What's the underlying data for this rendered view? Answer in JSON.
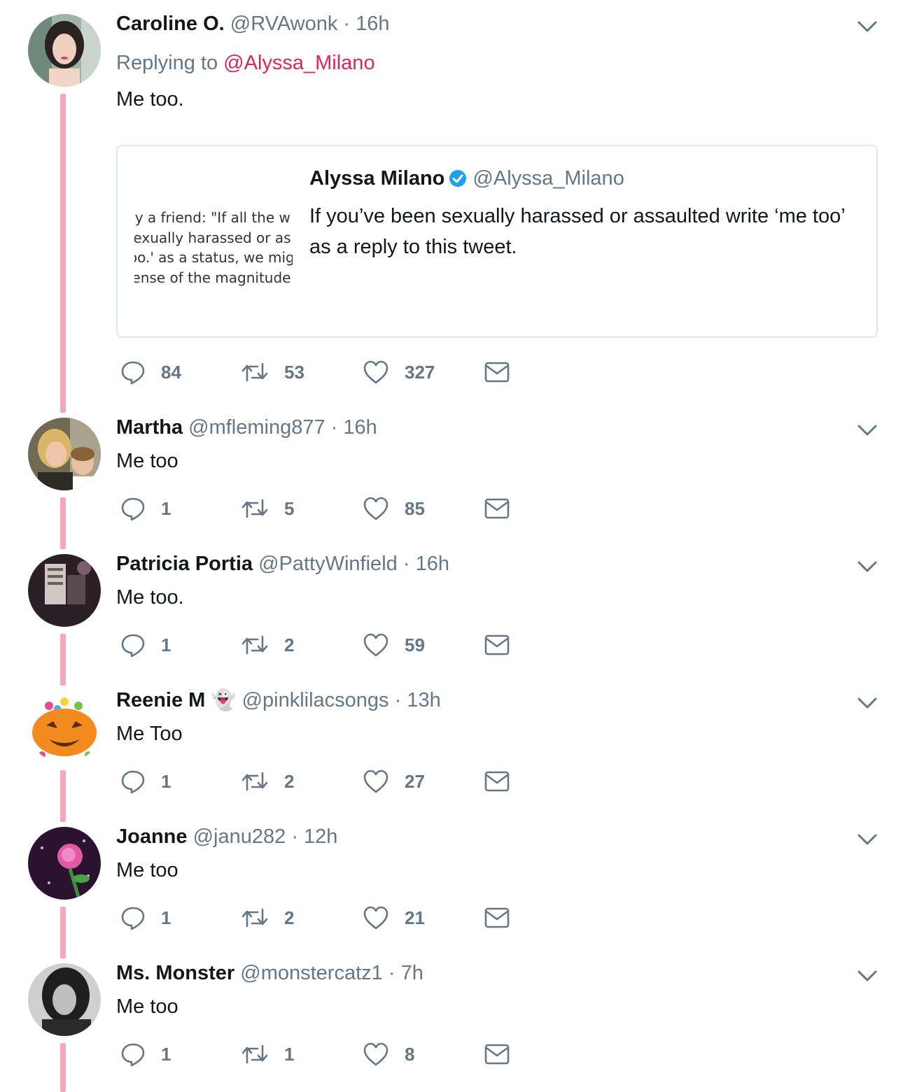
{
  "tweets": [
    {
      "name": "Caroline O.",
      "handle": "@RVAwonk",
      "time": "16h",
      "replying_prefix": "Replying to",
      "replying_mention": "@Alyssa_Milano",
      "text": "Me too.",
      "quote": {
        "name": "Alyssa Milano",
        "handle": "@Alyssa_Milano",
        "verified": true,
        "text": "If you’ve been sexually harassed or assaulted write ‘me too’ as a reply to this tweet.",
        "image_lines": [
          "by a friend: \"If all the w",
          "sexually harassed or as",
          "too.' as a status, we mig",
          "sense of the magnitude c"
        ]
      },
      "replies": "84",
      "retweets": "53",
      "likes": "327",
      "avatar_color": "#8aa39a"
    },
    {
      "name": "Martha",
      "handle": "@mfleming877",
      "time": "16h",
      "text": "Me too",
      "replies": "1",
      "retweets": "5",
      "likes": "85",
      "avatar_color": "#8a6a3c"
    },
    {
      "name": "Patricia Portia",
      "handle": "@PattyWinfield",
      "time": "16h",
      "text": "Me too.",
      "replies": "1",
      "retweets": "2",
      "likes": "59",
      "avatar_color": "#3a2b2f"
    },
    {
      "name": "Reenie M",
      "emoji": "👻",
      "handle": "@pinklilacsongs",
      "time": "13h",
      "text": "Me Too",
      "replies": "1",
      "retweets": "2",
      "likes": "27",
      "avatar_color": "#f28a1e"
    },
    {
      "name": "Joanne",
      "handle": "@janu282",
      "time": "12h",
      "text": "Me too",
      "replies": "1",
      "retweets": "2",
      "likes": "21",
      "avatar_color": "#2a1230"
    },
    {
      "name": "Ms. Monster",
      "handle": "@monstercatz1",
      "time": "7h",
      "text": "Me too",
      "replies": "1",
      "retweets": "1",
      "likes": "8",
      "avatar_color": "#3b3b3b"
    }
  ],
  "separator": "·",
  "colors": {
    "thread_line": "#f4a8ba",
    "mention": "#e0245e",
    "secondary": "#657786",
    "verified": "#1da1f2"
  },
  "icons": [
    "reply-icon",
    "retweet-icon",
    "like-icon",
    "direct-message-icon",
    "caret-down-icon",
    "verified-badge-icon"
  ]
}
